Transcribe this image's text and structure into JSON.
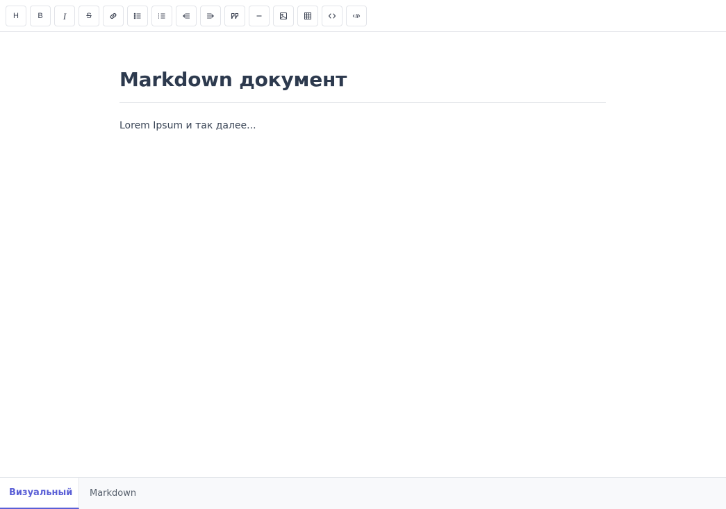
{
  "toolbar": {
    "buttons": [
      {
        "name": "heading-button",
        "icon": "heading-icon",
        "glyph": "H"
      },
      {
        "name": "bold-button",
        "icon": "bold-icon",
        "glyph": "B"
      },
      {
        "name": "italic-button",
        "icon": "italic-icon",
        "glyph": "I"
      },
      {
        "name": "strikethrough-button",
        "icon": "strikethrough-icon",
        "glyph": "S"
      },
      {
        "name": "link-button",
        "icon": "link-icon"
      },
      {
        "name": "bullet-list-button",
        "icon": "bullet-list-icon"
      },
      {
        "name": "ordered-list-button",
        "icon": "ordered-list-icon"
      },
      {
        "name": "outdent-button",
        "icon": "outdent-icon"
      },
      {
        "name": "indent-button",
        "icon": "indent-icon"
      },
      {
        "name": "blockquote-button",
        "icon": "blockquote-icon"
      },
      {
        "name": "horizontal-rule-button",
        "icon": "horizontal-rule-icon"
      },
      {
        "name": "image-button",
        "icon": "image-icon"
      },
      {
        "name": "table-button",
        "icon": "table-icon"
      },
      {
        "name": "inline-code-button",
        "icon": "code-icon"
      },
      {
        "name": "code-block-button",
        "icon": "code-block-icon"
      }
    ]
  },
  "document": {
    "title": "Markdown документ",
    "paragraph": "Lorem Ipsum и так далее..."
  },
  "tabs": {
    "visual": "Визуальный",
    "markdown": "Markdown",
    "active": "visual"
  },
  "colors": {
    "accent": "#5a5fd6",
    "text": "#2d3a4e",
    "border": "#e2e4e9",
    "bottom_bar_bg": "#f8f9fb"
  }
}
